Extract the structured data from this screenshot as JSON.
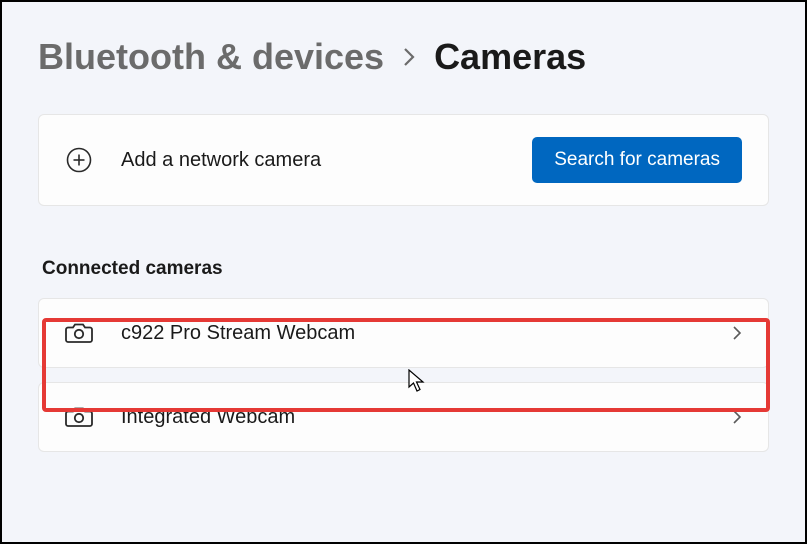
{
  "breadcrumb": {
    "parent": "Bluetooth & devices",
    "current": "Cameras"
  },
  "add_card": {
    "label": "Add a network camera",
    "button": "Search for cameras"
  },
  "section": {
    "header": "Connected cameras",
    "devices": [
      {
        "name": "c922 Pro Stream Webcam"
      },
      {
        "name": "Integrated Webcam"
      }
    ]
  }
}
